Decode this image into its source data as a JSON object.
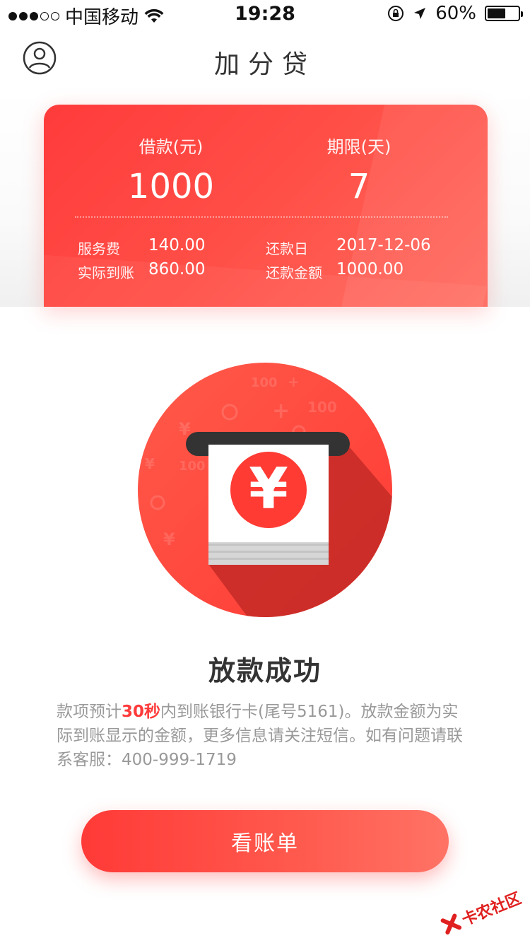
{
  "status_bar": {
    "carrier": "中国移动",
    "time": "19:28",
    "battery": "60%",
    "battery_level": 0.6
  },
  "nav": {
    "title": "加分贷"
  },
  "loan_card": {
    "amount_label": "借款(元)",
    "amount_value": "1000",
    "term_label": "期限(天)",
    "term_value": "7",
    "details": {
      "service_fee_label": "服务费",
      "service_fee_value": "140.00",
      "received_label": "实际到账",
      "received_value": "860.00",
      "repay_date_label": "还款日",
      "repay_date_value": "2017-12-06",
      "repay_amount_label": "还款金额",
      "repay_amount_value": "1000.00"
    }
  },
  "illustration": {
    "icon": "atm-cash-icon",
    "symbol": "¥",
    "background_labels": [
      "100",
      "100",
      "100",
      "¥",
      "¥",
      "¥",
      "+",
      "+"
    ]
  },
  "result": {
    "title": "放款成功",
    "desc_part1": "款项预计",
    "desc_highlight": "30秒",
    "desc_part2": "内到账银行卡(尾号5161)。放款金额为实际到账显示的金额，更多信息请关注短信。如有问题请联系客服：400-999-1719"
  },
  "button": {
    "label": "看账单"
  },
  "watermark": {
    "text": "卡农社区"
  },
  "colors": {
    "primary": "#ff3b3b",
    "text": "#333333",
    "muted": "#999999"
  }
}
